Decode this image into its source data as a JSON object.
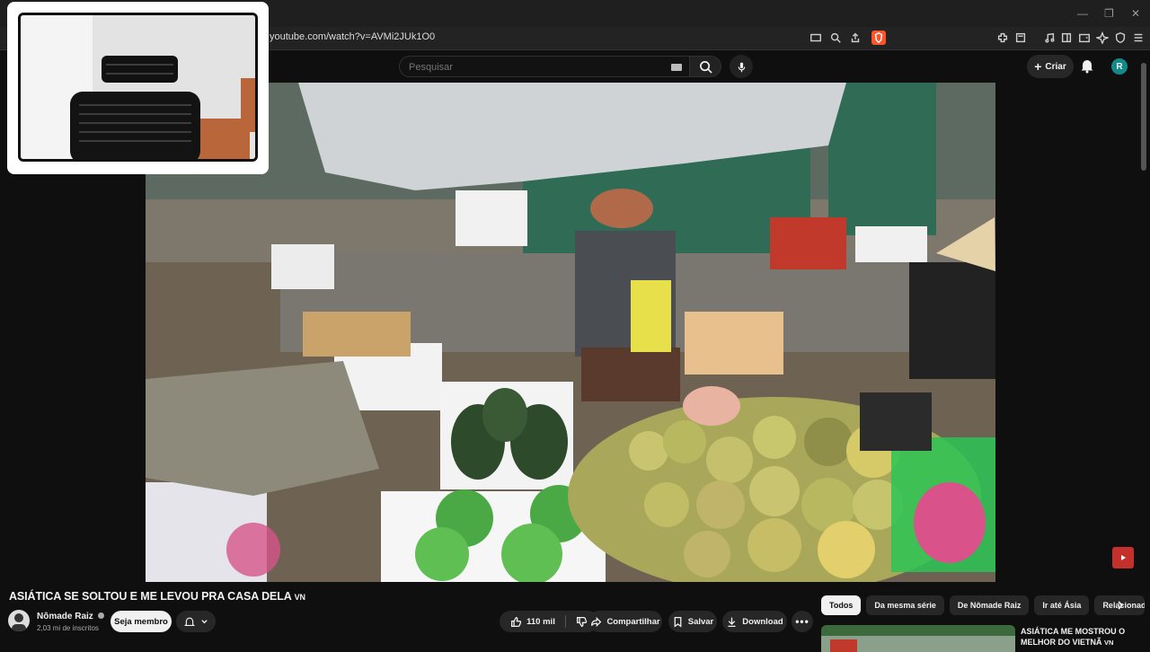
{
  "browser": {
    "url": "youtube.com/watch?v=AVMi2JUk1O0"
  },
  "header": {
    "search_placeholder": "Pesquisar",
    "create_label": "Criar",
    "avatar_letter": "R"
  },
  "video": {
    "title": "ASIÁTICA SE SOLTOU E ME LEVOU PRA CASA DELA",
    "title_flag": "VN"
  },
  "channel": {
    "name": "Nômade Raiz",
    "subscribers": "2,03 mi de inscritos",
    "member_label": "Seja membro"
  },
  "actions": {
    "likes": "110 mil",
    "share": "Compartilhar",
    "save": "Salvar",
    "download": "Download"
  },
  "chips": [
    "Todos",
    "Da mesma série",
    "De Nômade Raiz",
    "Ir até Ásia",
    "Relacionad"
  ],
  "recommendation": {
    "title": "ASIÁTICA ME MOSTROU O MELHOR DO VIETNÃ",
    "flag": "VN"
  },
  "colors": {
    "accent": "#ff0000",
    "background": "#0f0f0f",
    "avatar": "#138a8a"
  }
}
